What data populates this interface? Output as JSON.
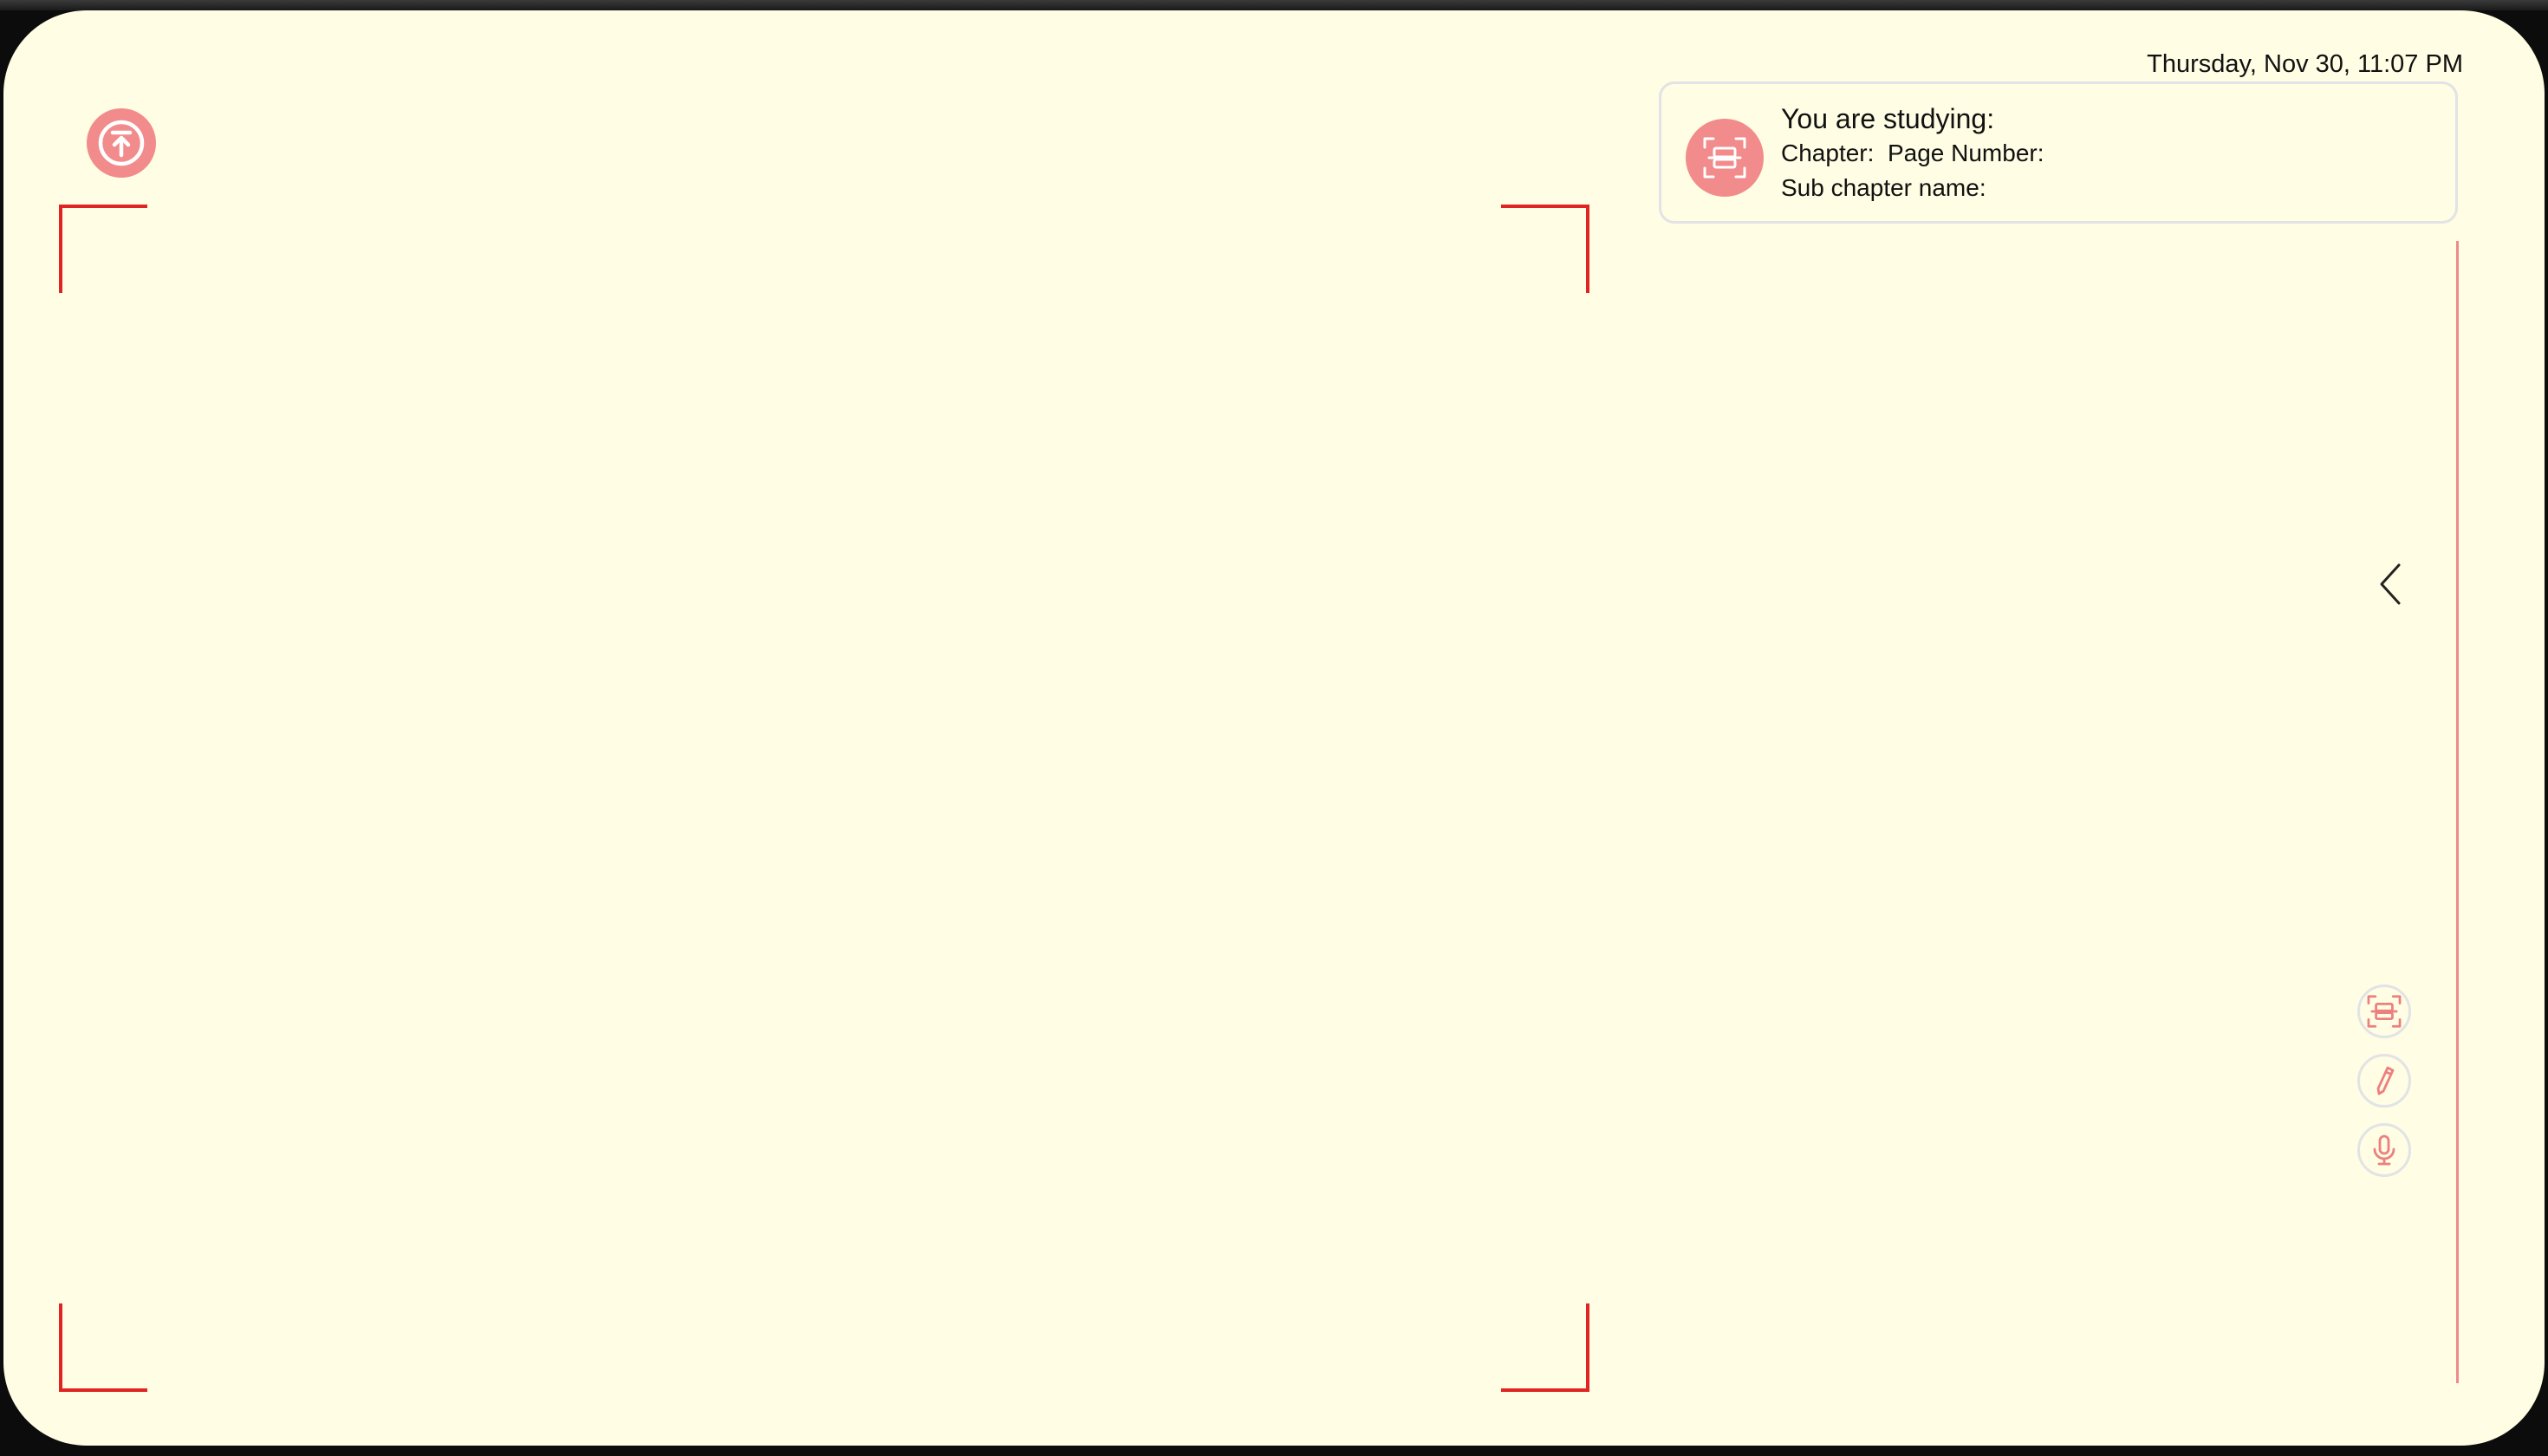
{
  "status_bar": {
    "datetime": "Thursday, Nov 30, 11:07 PM"
  },
  "study_card": {
    "title": "You are studying:",
    "chapter_label": "Chapter:",
    "chapter_value": "",
    "page_number_label": "Page Number:",
    "page_number_value": "",
    "subchapter_label": "Sub chapter name:",
    "subchapter_value": "",
    "icon": "scan-icon"
  },
  "toolbar": {
    "upload_icon": "upload-icon",
    "collapse_icon": "chevron-left-icon",
    "tools": [
      {
        "icon": "scan-icon"
      },
      {
        "icon": "pen-icon"
      },
      {
        "icon": "microphone-icon"
      }
    ]
  },
  "colors": {
    "background": "#fffde3",
    "accent": "#f28b8b",
    "frame_corner": "#e02424",
    "border": "#e1e3e6",
    "side_rule": "#f08a8a"
  }
}
